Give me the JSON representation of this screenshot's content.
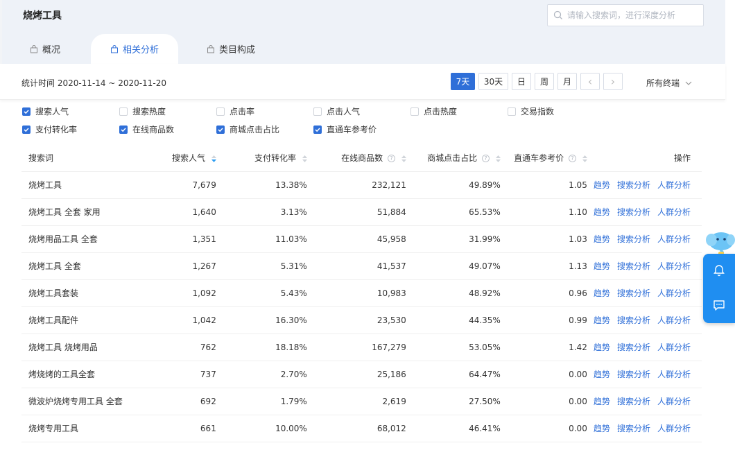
{
  "page": {
    "title": "烧烤工具"
  },
  "search": {
    "placeholder": "请输入搜索词，进行深度分析"
  },
  "tabs": [
    {
      "label": "概况"
    },
    {
      "label": "相关分析"
    },
    {
      "label": "类目构成"
    }
  ],
  "date_bar": {
    "label": "统计时间 2020-11-14 ~ 2020-11-20",
    "ranges": [
      "7天",
      "30天",
      "日",
      "周",
      "月"
    ],
    "prev": "‹",
    "next": "›",
    "terminal": "所有终端"
  },
  "metrics": [
    {
      "label": "搜索人气",
      "checked": true
    },
    {
      "label": "搜索热度",
      "checked": false
    },
    {
      "label": "点击率",
      "checked": false
    },
    {
      "label": "点击人气",
      "checked": false
    },
    {
      "label": "点击热度",
      "checked": false
    },
    {
      "label": "交易指数",
      "checked": false
    },
    {
      "label": "支付转化率",
      "checked": true
    },
    {
      "label": "在线商品数",
      "checked": true
    },
    {
      "label": "商城点击占比",
      "checked": true
    },
    {
      "label": "直通车参考价",
      "checked": true
    }
  ],
  "table": {
    "headers": [
      "搜索词",
      "搜索人气",
      "支付转化率",
      "在线商品数",
      "商城点击占比",
      "直通车参考价",
      "操作"
    ],
    "actions": [
      "趋势",
      "搜索分析",
      "人群分析"
    ],
    "rows": [
      [
        "烧烤工具",
        "7,679",
        "13.38%",
        "232,121",
        "49.89%",
        "1.05"
      ],
      [
        "烧烤工具 全套 家用",
        "1,640",
        "3.13%",
        "51,884",
        "65.53%",
        "1.10"
      ],
      [
        "烧烤用品工具 全套",
        "1,351",
        "11.03%",
        "45,958",
        "31.99%",
        "1.03"
      ],
      [
        "烧烤工具 全套",
        "1,267",
        "5.31%",
        "41,537",
        "49.07%",
        "1.13"
      ],
      [
        "烧烤工具套装",
        "1,092",
        "5.43%",
        "10,983",
        "48.92%",
        "0.96"
      ],
      [
        "烧烤工具配件",
        "1,042",
        "16.30%",
        "23,530",
        "44.35%",
        "0.99"
      ],
      [
        "烧烤工具 烧烤用品",
        "762",
        "18.18%",
        "167,279",
        "53.05%",
        "1.42"
      ],
      [
        "烤烧烤的工具全套",
        "737",
        "2.70%",
        "25,186",
        "64.47%",
        "0.00"
      ],
      [
        "微波炉烧烤专用工具 全套",
        "692",
        "1.79%",
        "2,619",
        "27.50%",
        "0.00"
      ],
      [
        "烧烤专用工具",
        "661",
        "10.00%",
        "68,012",
        "46.41%",
        "0.00"
      ]
    ]
  },
  "colors": {
    "accent": "#2f6fd8",
    "float_panel": "#1f8ef1",
    "header_bg": "#eef2f8"
  }
}
